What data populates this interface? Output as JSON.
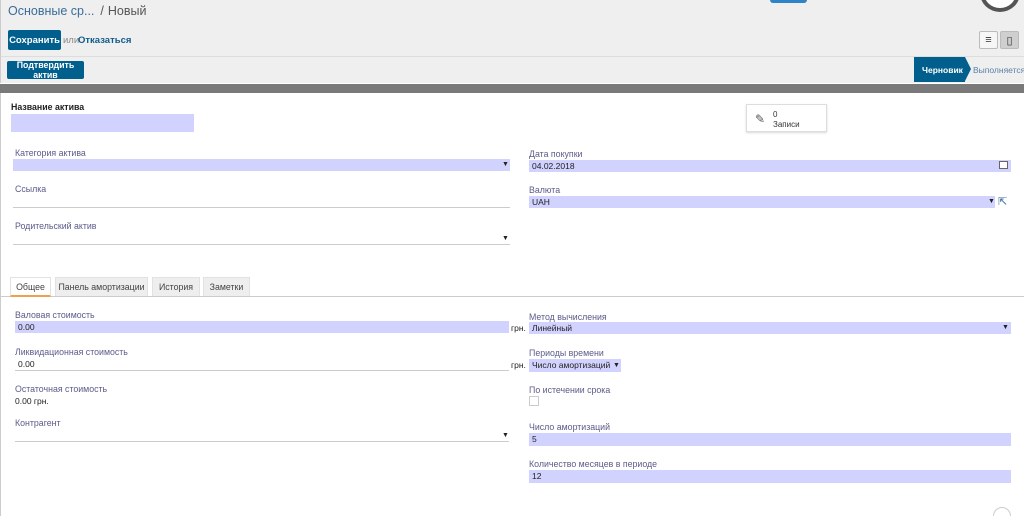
{
  "header": {
    "breadcrumb_parent": "Основные ср...",
    "breadcrumb_separator": "/",
    "breadcrumb_current": "Новый",
    "save_label": "Сохранить",
    "or_label": "или",
    "discard_label": "Отказаться"
  },
  "statusbar": {
    "confirm_label": "Подтвердить актив",
    "stage_current": "Черновик",
    "stage_next": "Выполняется"
  },
  "form": {
    "name_label": "Название актива",
    "name_value": "",
    "records_count": "0",
    "records_label": "Записи",
    "category_label": "Категория актива",
    "category_value": "",
    "reference_label": "Ссылка",
    "reference_value": "",
    "parent_label": "Родительский актив",
    "parent_value": "",
    "purchase_date_label": "Дата покупки",
    "purchase_date_value": "04.02.2018",
    "currency_label": "Валюта",
    "currency_value": "UAH"
  },
  "tabs": [
    {
      "label": "Общее"
    },
    {
      "label": "Панель амортизации"
    },
    {
      "label": "История"
    },
    {
      "label": "Заметки"
    }
  ],
  "general": {
    "gross_label": "Валовая стоимость",
    "gross_value": "0.00",
    "gross_unit": "грн.",
    "salvage_label": "Ликвидационная стоимость",
    "salvage_value": "0.00",
    "salvage_unit": "грн.",
    "residual_label": "Остаточная стоимость",
    "residual_value": "0.00 грн.",
    "partner_label": "Контрагент",
    "partner_value": "",
    "method_label": "Метод вычисления",
    "method_value": "Линейный",
    "time_label": "Периоды времени",
    "time_value": "Число амортизаций",
    "prorata_label": "По истечении срока",
    "number_label": "Число амортизаций",
    "number_value": "5",
    "months_label": "Количество месяцев в периоде",
    "months_value": "12"
  }
}
